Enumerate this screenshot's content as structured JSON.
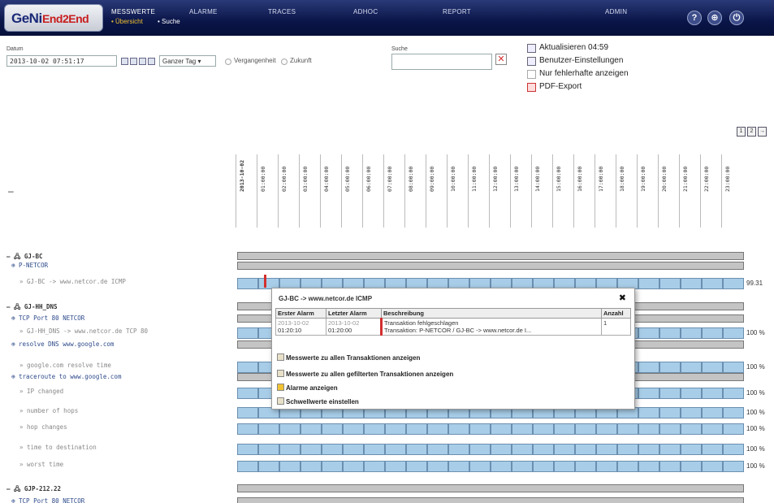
{
  "app": {
    "logo_main": "GeNi",
    "logo_sub": "End2End"
  },
  "nav": {
    "items": [
      "MESSWERTE",
      "ALARME",
      "TRACES",
      "ADHOC",
      "REPORT",
      "ADMIN"
    ],
    "subitems": [
      "Übersicht",
      "Suche"
    ]
  },
  "controls": {
    "datum_label": "Datum",
    "datum_value": "2013-10-02 07:51:17",
    "range_value": "Ganzer Tag",
    "past_label": "Vergangenheit",
    "future_label": "Zukunft",
    "search_label": "Suche",
    "search_value": ""
  },
  "right_links": {
    "refresh": "Aktualisieren 04:59",
    "settings": "Benutzer-Einstellungen",
    "only_errors": "Nur fehlerhafte anzeigen",
    "pdf": "PDF-Export"
  },
  "pager": [
    "1",
    "2",
    "→"
  ],
  "collapse_all": "–",
  "columns": [
    "2013-10-02",
    "01:00:00",
    "02:00:00",
    "03:00:00",
    "04:00:00",
    "05:00:00",
    "06:00:00",
    "07:00:00",
    "08:00:00",
    "09:00:00",
    "10:00:00",
    "11:00:00",
    "12:00:00",
    "13:00:00",
    "14:00:00",
    "15:00:00",
    "16:00:00",
    "17:00:00",
    "18:00:00",
    "19:00:00",
    "20:00:00",
    "21:00:00",
    "22:00:00",
    "23:00:00"
  ],
  "tree": [
    {
      "label": "– 🖧 GJ-BC",
      "level": 0
    },
    {
      "label": "⊕ P-NETCOR",
      "level": 1
    },
    {
      "label": "» GJ-BC -> www.netcor.de ICMP",
      "level": 2
    },
    {
      "label": "– 🖧 GJ-HH_DNS",
      "level": 0
    },
    {
      "label": "⊕ TCP Port 80 NETCOR",
      "level": 1
    },
    {
      "label": "» GJ-HH_DNS -> www.netcor.de TCP 80",
      "level": 2
    },
    {
      "label": "⊕ resolve DNS www.google.com",
      "level": 1
    },
    {
      "label": "» google.com resolve time",
      "level": 2
    },
    {
      "label": "⊕ traceroute to www.google.com",
      "level": 1
    },
    {
      "label": "» IP changed",
      "level": 2
    },
    {
      "label": "» number of hops",
      "level": 2
    },
    {
      "label": "» hop changes",
      "level": 2
    },
    {
      "label": "» time to destination",
      "level": 2
    },
    {
      "label": "» worst time",
      "level": 2
    },
    {
      "label": "– 🖧 GJP-212.22",
      "level": 0
    },
    {
      "label": "⊕ TCP Port 80 NETCOR",
      "level": 1
    }
  ],
  "row_values": [
    "99.31",
    "100 %",
    "100 %",
    "100 %",
    "100 %",
    "100 %",
    "100 %",
    "100 %"
  ],
  "popup": {
    "title": "GJ-BC -> www.netcor.de ICMP",
    "close": "✖",
    "headers": [
      "Erster Alarm",
      "Letzter Alarm",
      "Beschreibung",
      "Anzahl"
    ],
    "row": {
      "first_date": "2013-10-02",
      "first_time": "01:20:10",
      "last_date": "2013-10-02",
      "last_time": "01:20:00",
      "desc1": "Transaktion fehlgeschlagen",
      "desc2": "Transaktion: P-NETCOR / GJ-BC -> www.netcor.de I...",
      "count": "1"
    },
    "actions": [
      "Messwerte zu allen Transaktionen anzeigen",
      "Messwerte zu allen gefilterten Transaktionen anzeigen",
      "Alarme anzeigen",
      "Schwellwerte einstellen"
    ]
  },
  "colors": {
    "accent": "#0a1548",
    "track": "#a8cde8",
    "alarm": "#d32f2f"
  }
}
